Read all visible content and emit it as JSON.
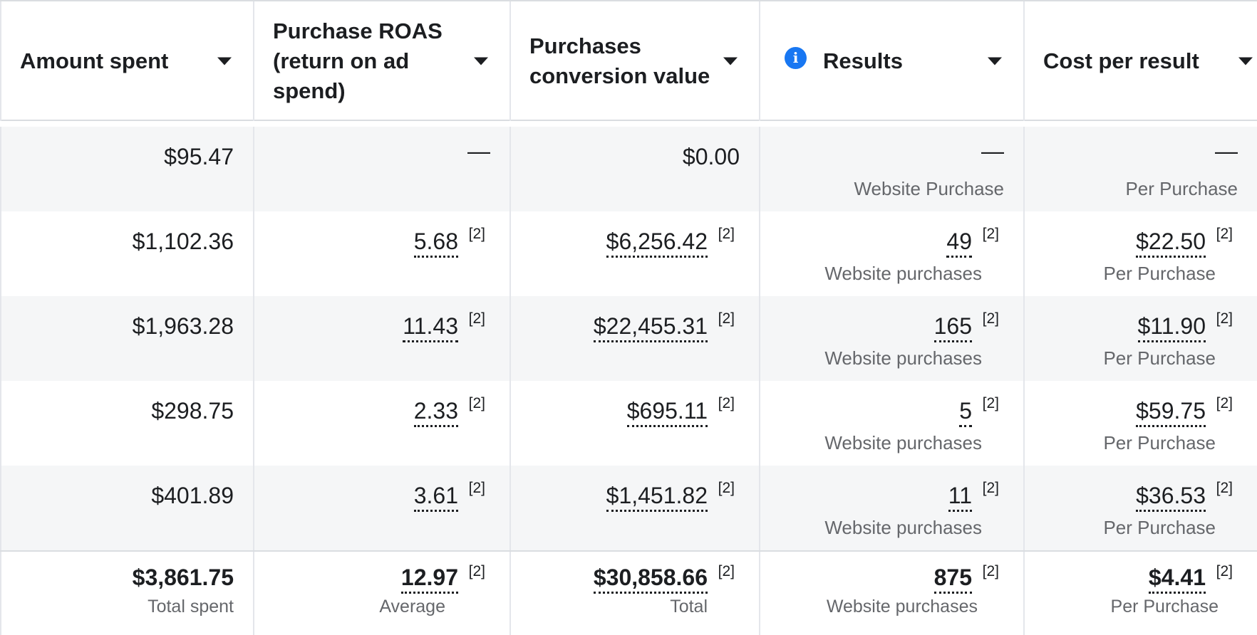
{
  "columns": [
    {
      "label": "Amount spent"
    },
    {
      "label": "Purchase ROAS (return on ad spend)"
    },
    {
      "label": "Purchases conversion value"
    },
    {
      "label": "Results"
    },
    {
      "label": "Cost per result"
    }
  ],
  "rows": [
    {
      "amount": "$95.47",
      "roas": "—",
      "conv": "$0.00",
      "results": "—",
      "results_sub": "Website Purchase",
      "cpr": "—",
      "cpr_sub": "Per Purchase"
    },
    {
      "amount": "$1,102.36",
      "roas": "5.68",
      "conv": "$6,256.42",
      "results": "49",
      "results_sub": "Website purchases",
      "cpr": "$22.50",
      "cpr_sub": "Per Purchase"
    },
    {
      "amount": "$1,963.28",
      "roas": "11.43",
      "conv": "$22,455.31",
      "results": "165",
      "results_sub": "Website purchases",
      "cpr": "$11.90",
      "cpr_sub": "Per Purchase"
    },
    {
      "amount": "$298.75",
      "roas": "2.33",
      "conv": "$695.11",
      "results": "5",
      "results_sub": "Website purchases",
      "cpr": "$59.75",
      "cpr_sub": "Per Purchase"
    },
    {
      "amount": "$401.89",
      "roas": "3.61",
      "conv": "$1,451.82",
      "results": "11",
      "results_sub": "Website purchases",
      "cpr": "$36.53",
      "cpr_sub": "Per Purchase"
    }
  ],
  "footnote": "[2]",
  "totals": {
    "amount": "$3,861.75",
    "amount_sub": "Total spent",
    "roas": "12.97",
    "roas_sub": "Average",
    "conv": "$30,858.66",
    "conv_sub": "Total",
    "results": "875",
    "results_sub": "Website purchases",
    "cpr": "$4.41",
    "cpr_sub": "Per Purchase"
  }
}
